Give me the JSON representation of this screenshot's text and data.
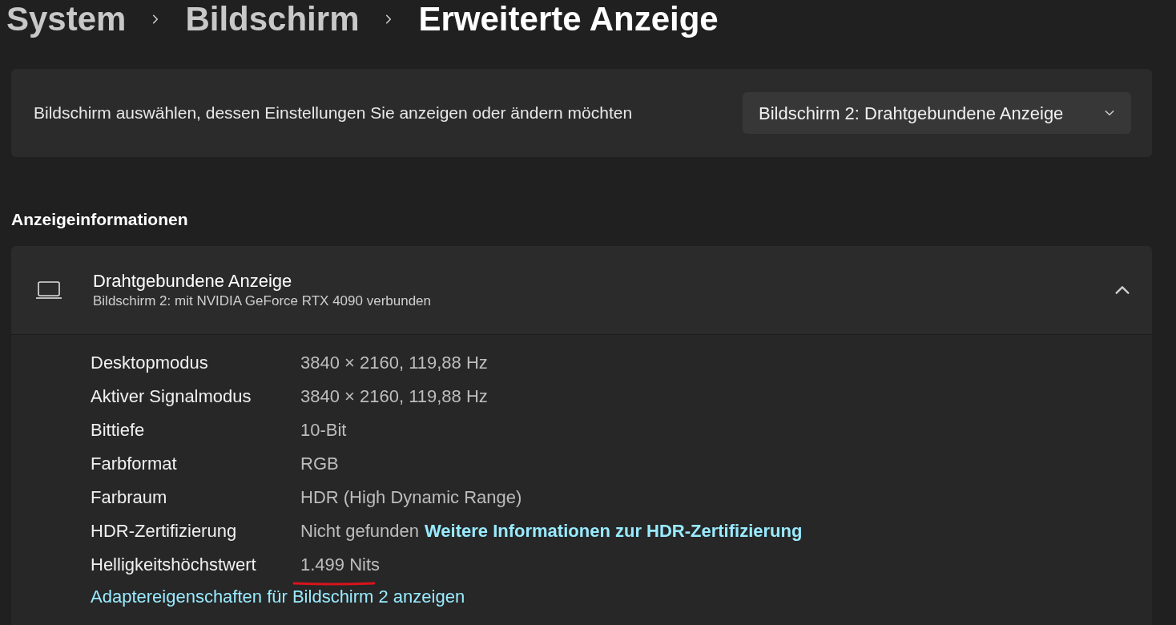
{
  "breadcrumb": [
    {
      "label": "System",
      "current": false
    },
    {
      "label": "Bildschirm",
      "current": false
    },
    {
      "label": "Erweiterte Anzeige",
      "current": true
    }
  ],
  "display_select": {
    "label": "Bildschirm auswählen, dessen Einstellungen Sie anzeigen oder ändern möchten",
    "value": "Bildschirm 2: Drahtgebundene Anzeige"
  },
  "section_title": "Anzeigeinformationen",
  "display_card": {
    "title": "Drahtgebundene Anzeige",
    "subtitle": "Bildschirm 2: mit NVIDIA GeForce RTX 4090 verbunden",
    "expanded": true,
    "rows": [
      {
        "label": "Desktopmodus",
        "value": "3840 × 2160, 119,88 Hz",
        "underlined": false
      },
      {
        "label": "Aktiver Signalmodus",
        "value": "3840 × 2160, 119,88 Hz",
        "underlined": false
      },
      {
        "label": "Bittiefe",
        "value": "10-Bit",
        "underlined": false
      },
      {
        "label": "Farbformat",
        "value": "RGB",
        "underlined": false
      },
      {
        "label": "Farbraum",
        "value": "HDR (High Dynamic Range)",
        "underlined": false
      },
      {
        "label": "HDR-Zertifizierung",
        "value": "Nicht gefunden",
        "link": "Weitere Informationen zur HDR-Zertifizierung",
        "underlined": false
      },
      {
        "label": "Helligkeitshöchstwert",
        "value": "1.499 Nits",
        "underlined": true
      }
    ],
    "footer_link": "Adaptereigenschaften für Bildschirm 2 anzeigen"
  }
}
